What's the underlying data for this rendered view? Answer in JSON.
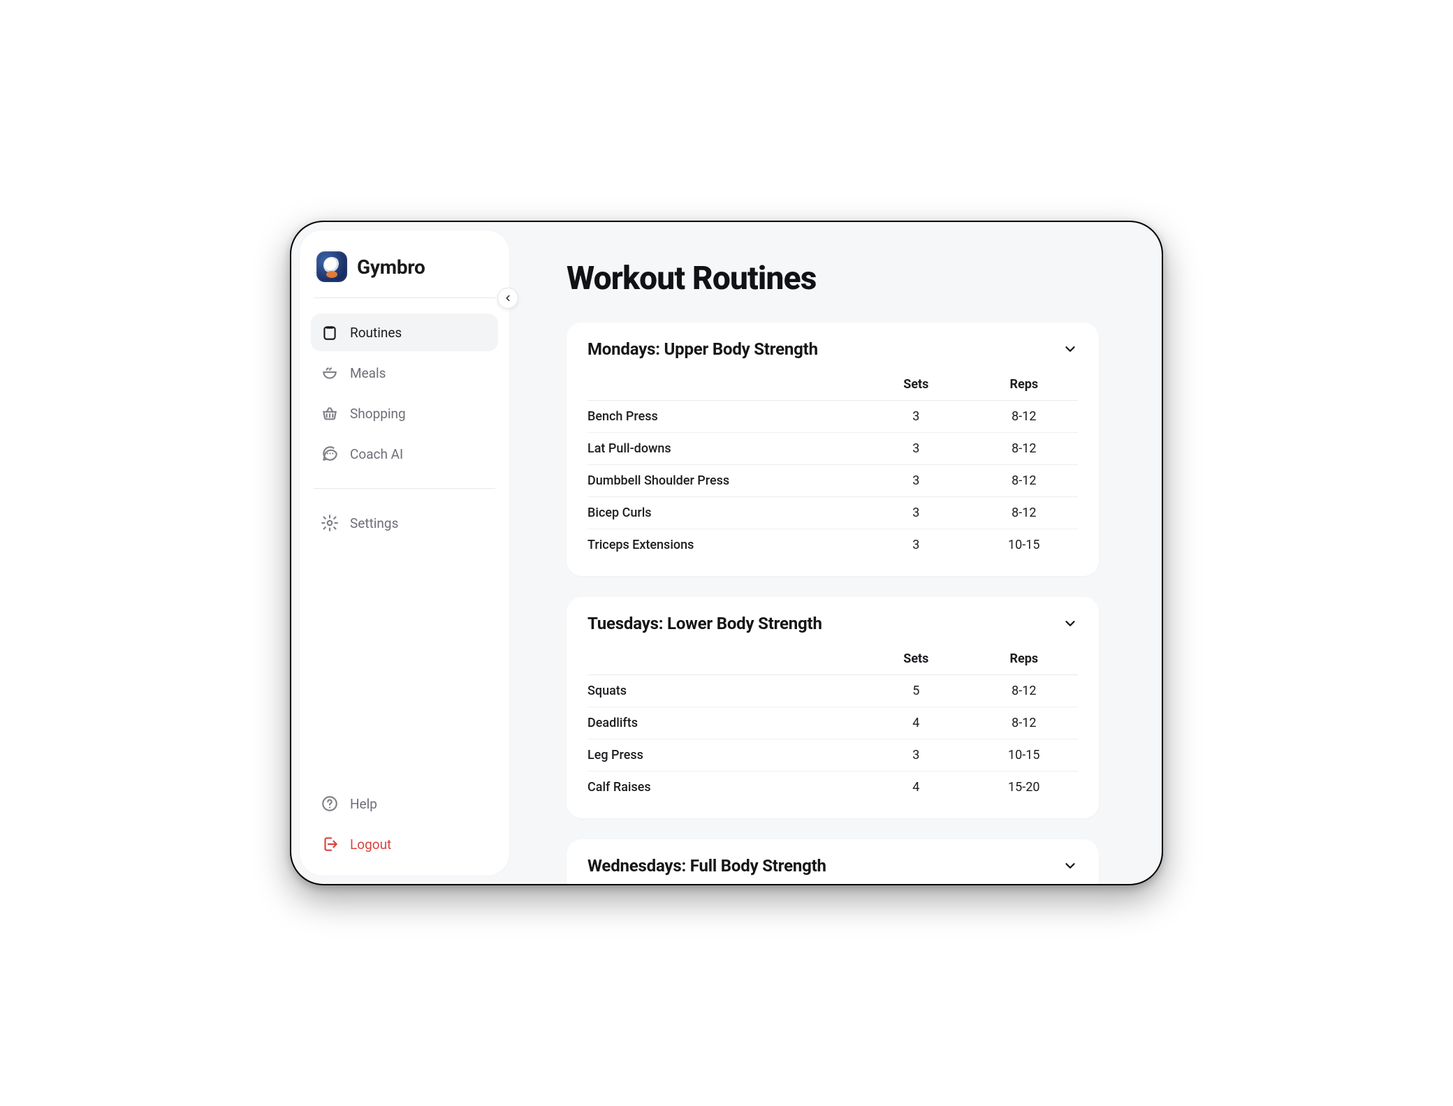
{
  "brand": {
    "name": "Gymbro"
  },
  "sidebar": {
    "main_items": [
      {
        "id": "routines",
        "label": "Routines",
        "icon": "clipboard-icon",
        "active": true
      },
      {
        "id": "meals",
        "label": "Meals",
        "icon": "bowl-icon",
        "active": false
      },
      {
        "id": "shopping",
        "label": "Shopping",
        "icon": "basket-icon",
        "active": false
      },
      {
        "id": "coach-ai",
        "label": "Coach AI",
        "icon": "chat-icon",
        "active": false
      }
    ],
    "secondary_items": [
      {
        "id": "settings",
        "label": "Settings",
        "icon": "gear-icon"
      }
    ],
    "footer_items": [
      {
        "id": "help",
        "label": "Help",
        "icon": "help-icon",
        "danger": false
      },
      {
        "id": "logout",
        "label": "Logout",
        "icon": "logout-icon",
        "danger": true
      }
    ]
  },
  "page": {
    "title": "Workout Routines",
    "table_headers": {
      "name": "",
      "sets": "Sets",
      "reps": "Reps"
    },
    "routines": [
      {
        "title": "Mondays: Upper Body Strength",
        "exercises": [
          {
            "name": "Bench Press",
            "sets": "3",
            "reps": "8-12"
          },
          {
            "name": "Lat Pull-downs",
            "sets": "3",
            "reps": "8-12"
          },
          {
            "name": "Dumbbell Shoulder Press",
            "sets": "3",
            "reps": "8-12"
          },
          {
            "name": "Bicep Curls",
            "sets": "3",
            "reps": "8-12"
          },
          {
            "name": "Triceps Extensions",
            "sets": "3",
            "reps": "10-15"
          }
        ]
      },
      {
        "title": "Tuesdays: Lower Body Strength",
        "exercises": [
          {
            "name": "Squats",
            "sets": "5",
            "reps": "8-12"
          },
          {
            "name": "Deadlifts",
            "sets": "4",
            "reps": "8-12"
          },
          {
            "name": "Leg Press",
            "sets": "3",
            "reps": "10-15"
          },
          {
            "name": "Calf Raises",
            "sets": "4",
            "reps": "15-20"
          }
        ]
      },
      {
        "title": "Wednesdays: Full Body Strength",
        "exercises": []
      }
    ]
  }
}
